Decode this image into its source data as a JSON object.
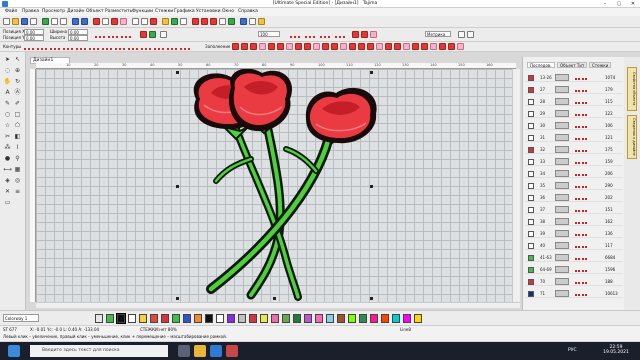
{
  "window": {
    "title": "[Ultimate Special Edition] - [Дизайн1] - Tajima",
    "title_short": "[Ultimate Special Edition]",
    "doc_label": "[Дизайн1]",
    "brand": "Tajima"
  },
  "menu": [
    "Файл",
    "Правка",
    "Просмотр",
    "Дизайн",
    "Объект",
    "Разместить",
    "Функции",
    "Стежки",
    "Графика",
    "Установки",
    "Окно",
    "Справка"
  ],
  "toolbar2": {
    "pos_x_label": "Позиция X",
    "pos_x_value": "0.00",
    "width_label": "Ширина",
    "width_value": "0.00",
    "pos_y_label": "Позиция Y",
    "pos_y_value": "0.00",
    "height_label": "Высота",
    "height_value": "0.00",
    "zoom_value": "100",
    "metric": "Метрика",
    "contours_label": "Контуры",
    "fill_label": "Заполнение"
  },
  "document_tab": "Дизайн1",
  "ruler_top_ticks": [
    "10",
    "20",
    "30",
    "40",
    "50",
    "60",
    "70",
    "80",
    "90",
    "100",
    "110",
    "120",
    "130",
    "140",
    "150",
    "160"
  ],
  "right_panel": {
    "tabs": [
      "Последов.",
      "Объект Тит",
      "Стежки"
    ],
    "rows": [
      {
        "color": "#d9323c",
        "num": "13-26",
        "count": "1074"
      },
      {
        "color": "#d9323c",
        "num": "27",
        "count": "179"
      },
      {
        "color": "#ffffff",
        "num": "28",
        "count": "115"
      },
      {
        "color": "#ffffff",
        "num": "29",
        "count": "122"
      },
      {
        "color": "#ffffff",
        "num": "30",
        "count": "106"
      },
      {
        "color": "#ffffff",
        "num": "31",
        "count": "121"
      },
      {
        "color": "#d9323c",
        "num": "32",
        "count": "175"
      },
      {
        "color": "#ffffff",
        "num": "33",
        "count": "159"
      },
      {
        "color": "#ffffff",
        "num": "34",
        "count": "206"
      },
      {
        "color": "#ffffff",
        "num": "35",
        "count": "290"
      },
      {
        "color": "#ffffff",
        "num": "36",
        "count": "202"
      },
      {
        "color": "#ffffff",
        "num": "37",
        "count": "151"
      },
      {
        "color": "#ffffff",
        "num": "38",
        "count": "162"
      },
      {
        "color": "#ffffff",
        "num": "39",
        "count": "136"
      },
      {
        "color": "#ffffff",
        "num": "40",
        "count": "117"
      },
      {
        "color": "#3fbf4a",
        "num": "41-63",
        "count": "6684"
      },
      {
        "color": "#3fbf4a",
        "num": "64-69",
        "count": "1596"
      },
      {
        "color": "#d9323c",
        "num": "70",
        "count": "188"
      },
      {
        "color": "#1b2b7a",
        "num": "71",
        "count": "10613"
      }
    ],
    "side_tabs": [
      "Свойства объекта",
      "Сведения о дизайне"
    ]
  },
  "palette": {
    "label": "Colorway 1",
    "colors": [
      "#e6e6e6",
      "#3fbf4a",
      "#111111",
      "#ffffff",
      "#f5d23a",
      "#e04a3c",
      "#d9323c",
      "#3fbf4a",
      "#2b56c9",
      "#f08a2a",
      "#111111",
      "#ffffff",
      "#8a2be2",
      "#c0c0c0",
      "#d9323c",
      "#e8e84a",
      "#f06ca8",
      "#6aa84f",
      "#1f7a3b",
      "#ba55d3",
      "#ff69b4",
      "#87ceeb",
      "#a0522d",
      "#7fff00",
      "#2e8b57",
      "#ff1493",
      "#ff4500",
      "#00ced1",
      "#ff00ff",
      "#ffd700"
    ]
  },
  "status": {
    "stitches": "ST 677",
    "coords": "X: -0.01 Yc: -0.0    L: 0.40 A: -133.04",
    "zoom": "СТЕЖКИ:нет 80%",
    "lang": "Line8",
    "hint": "Левый клик – увеличение, правый клик – уменьшение, клик + перемещение – масштабирование рамкой."
  },
  "taskbar": {
    "search_placeholder": "Введите здесь текст для поиска",
    "time": "22:59",
    "date": "19.05.2021",
    "lang": "РУС"
  }
}
